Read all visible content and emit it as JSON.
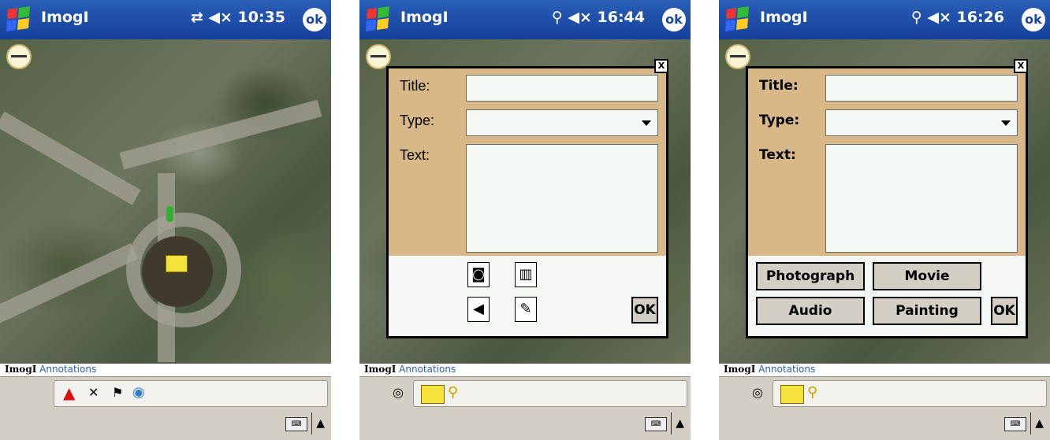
{
  "app_title": "ImogI",
  "screens": [
    {
      "time": "10:35",
      "status_icons": "⇄ ◀×",
      "ok": "ok"
    },
    {
      "time": "16:44",
      "status_icons": "⚲ ◀×",
      "ok": "ok"
    },
    {
      "time": "16:26",
      "status_icons": "⚲ ◀×",
      "ok": "ok"
    }
  ],
  "tabs": {
    "main": "ImogI",
    "annotations": "Annotations"
  },
  "dialog": {
    "close": "X",
    "title_label": "Title:",
    "type_label": "Type:",
    "text_label": "Text:",
    "ok": "OK"
  },
  "media_buttons": {
    "photograph": "Photograph",
    "movie": "Movie",
    "audio": "Audio",
    "painting": "Painting"
  },
  "icons": {
    "camera": "camera-icon",
    "film": "film-icon",
    "speaker": "speaker-icon",
    "paint": "paint-icon"
  }
}
